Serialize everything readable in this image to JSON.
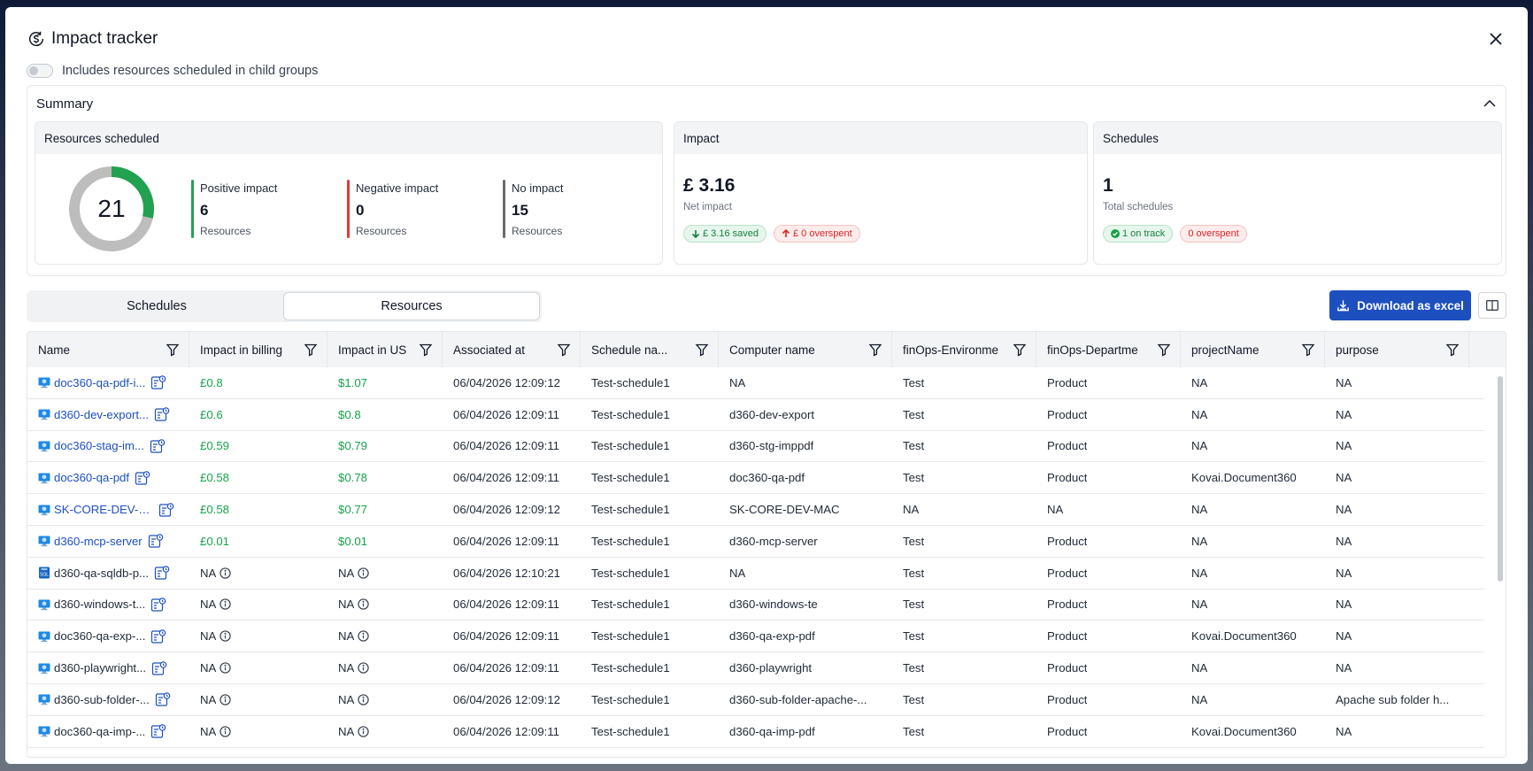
{
  "modal": {
    "title": "Impact tracker",
    "toggle_label": "Includes resources scheduled in child groups"
  },
  "summary": {
    "title": "Summary",
    "resources_card": {
      "title": "Resources scheduled",
      "total": "21",
      "donut": {
        "positive": 6,
        "negative": 0,
        "none": 15,
        "positive_color": "#22a150",
        "none_color": "#bdbdbd"
      },
      "stats": [
        {
          "label": "Positive impact",
          "value": "6",
          "unit": "Resources",
          "color": "#22a150"
        },
        {
          "label": "Negative impact",
          "value": "0",
          "unit": "Resources",
          "color": "#e53935"
        },
        {
          "label": "No impact",
          "value": "15",
          "unit": "Resources",
          "color": "#6b6b6b"
        }
      ]
    },
    "impact_card": {
      "title": "Impact",
      "value": "£ 3.16",
      "sub_label": "Net impact",
      "saved_pill": "£ 3.16 saved",
      "overspent_pill": "£ 0 overspent"
    },
    "schedules_card": {
      "title": "Schedules",
      "value": "1",
      "sub_label": "Total schedules",
      "on_track_pill": "1 on track",
      "overspent_pill": "0 overspent"
    }
  },
  "tabs": {
    "schedules": "Schedules",
    "resources": "Resources",
    "active": "resources"
  },
  "download_label": "Download as excel",
  "table": {
    "columns": [
      "Name",
      "Impact in billing",
      "Impact in US",
      "Associated at",
      "Schedule na...",
      "Computer name",
      "finOps-Environme",
      "finOps-Departme",
      "projectName",
      "purpose"
    ],
    "rows": [
      {
        "name": "doc360-qa-pdf-i...",
        "billing": "£0.8",
        "usd": "$1.07",
        "assoc": "06/04/2026 12:09:12",
        "schedule": "Test-schedule1",
        "computer": "NA",
        "env": "Test",
        "dept": "Product",
        "project": "NA",
        "purpose": "NA",
        "link": true,
        "info": false,
        "icon": "vm"
      },
      {
        "name": "d360-dev-export...",
        "billing": "£0.6",
        "usd": "$0.8",
        "assoc": "06/04/2026 12:09:11",
        "schedule": "Test-schedule1",
        "computer": "d360-dev-export",
        "env": "Test",
        "dept": "Product",
        "project": "NA",
        "purpose": "NA",
        "link": true,
        "info": false,
        "icon": "vm"
      },
      {
        "name": "doc360-stag-im...",
        "billing": "£0.59",
        "usd": "$0.79",
        "assoc": "06/04/2026 12:09:11",
        "schedule": "Test-schedule1",
        "computer": "d360-stg-imppdf",
        "env": "Test",
        "dept": "Product",
        "project": "NA",
        "purpose": "NA",
        "link": true,
        "info": false,
        "icon": "vm"
      },
      {
        "name": "doc360-qa-pdf",
        "billing": "£0.58",
        "usd": "$0.78",
        "assoc": "06/04/2026 12:09:11",
        "schedule": "Test-schedule1",
        "computer": "doc360-qa-pdf",
        "env": "Test",
        "dept": "Product",
        "project": "Kovai.Document360",
        "purpose": "NA",
        "link": true,
        "info": false,
        "icon": "vm"
      },
      {
        "name": "SK-CORE-DEV-M...",
        "billing": "£0.58",
        "usd": "$0.77",
        "assoc": "06/04/2026 12:09:12",
        "schedule": "Test-schedule1",
        "computer": "SK-CORE-DEV-MAC",
        "env": "NA",
        "dept": "NA",
        "project": "NA",
        "purpose": "NA",
        "link": true,
        "info": false,
        "icon": "vm"
      },
      {
        "name": "d360-mcp-server",
        "billing": "£0.01",
        "usd": "$0.01",
        "assoc": "06/04/2026 12:09:11",
        "schedule": "Test-schedule1",
        "computer": "d360-mcp-server",
        "env": "Test",
        "dept": "Product",
        "project": "NA",
        "purpose": "NA",
        "link": true,
        "info": false,
        "icon": "vm"
      },
      {
        "name": "d360-qa-sqldb-p...",
        "billing": "NA",
        "usd": "NA",
        "assoc": "06/04/2026 12:10:21",
        "schedule": "Test-schedule1",
        "computer": "NA",
        "env": "Test",
        "dept": "Product",
        "project": "NA",
        "purpose": "NA",
        "link": false,
        "info": true,
        "icon": "sql"
      },
      {
        "name": "d360-windows-t...",
        "billing": "NA",
        "usd": "NA",
        "assoc": "06/04/2026 12:09:11",
        "schedule": "Test-schedule1",
        "computer": "d360-windows-te",
        "env": "Test",
        "dept": "Product",
        "project": "NA",
        "purpose": "NA",
        "link": false,
        "info": true,
        "icon": "vm"
      },
      {
        "name": "doc360-qa-exp-...",
        "billing": "NA",
        "usd": "NA",
        "assoc": "06/04/2026 12:09:11",
        "schedule": "Test-schedule1",
        "computer": "d360-qa-exp-pdf",
        "env": "Test",
        "dept": "Product",
        "project": "Kovai.Document360",
        "purpose": "NA",
        "link": false,
        "info": true,
        "icon": "vm"
      },
      {
        "name": "d360-playwright...",
        "billing": "NA",
        "usd": "NA",
        "assoc": "06/04/2026 12:09:11",
        "schedule": "Test-schedule1",
        "computer": "d360-playwright",
        "env": "Test",
        "dept": "Product",
        "project": "NA",
        "purpose": "NA",
        "link": false,
        "info": true,
        "icon": "vm"
      },
      {
        "name": "d360-sub-folder-...",
        "billing": "NA",
        "usd": "NA",
        "assoc": "06/04/2026 12:09:12",
        "schedule": "Test-schedule1",
        "computer": "d360-sub-folder-apache-...",
        "env": "Test",
        "dept": "Product",
        "project": "NA",
        "purpose": "Apache sub folder h...",
        "link": false,
        "info": true,
        "icon": "vm"
      },
      {
        "name": "doc360-qa-imp-...",
        "billing": "NA",
        "usd": "NA",
        "assoc": "06/04/2026 12:09:11",
        "schedule": "Test-schedule1",
        "computer": "d360-qa-imp-pdf",
        "env": "Test",
        "dept": "Product",
        "project": "Kovai.Document360",
        "purpose": "NA",
        "link": false,
        "info": true,
        "icon": "vm"
      }
    ]
  },
  "colors": {
    "accent": "#1d4fbf",
    "positive": "#16a34a",
    "negative": "#dc2626"
  }
}
